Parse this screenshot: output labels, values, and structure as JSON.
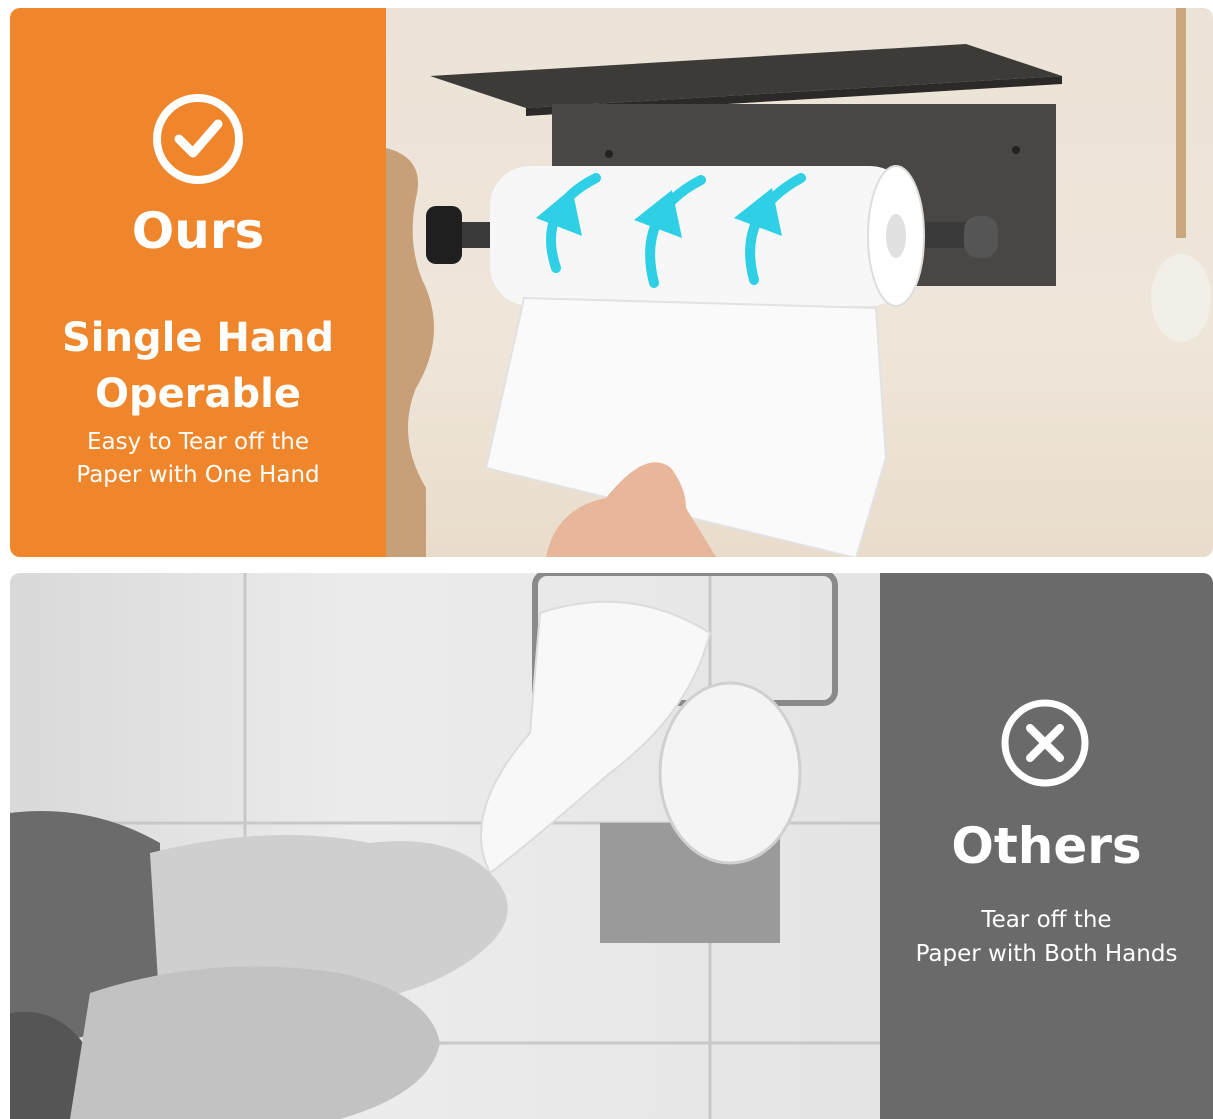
{
  "ours": {
    "badge_icon": "check-circle-icon",
    "heading": "Ours",
    "feature_line1": "Single Hand",
    "feature_line2": "Operable",
    "desc_line1": "Easy to Tear off the",
    "desc_line2": "Paper with One Hand",
    "panel_color": "#f0862b"
  },
  "others": {
    "badge_icon": "x-circle-icon",
    "heading": "Others",
    "desc_line1": "Tear off the",
    "desc_line2": "Paper with Both Hands",
    "panel_color": "#6a6a6a"
  }
}
